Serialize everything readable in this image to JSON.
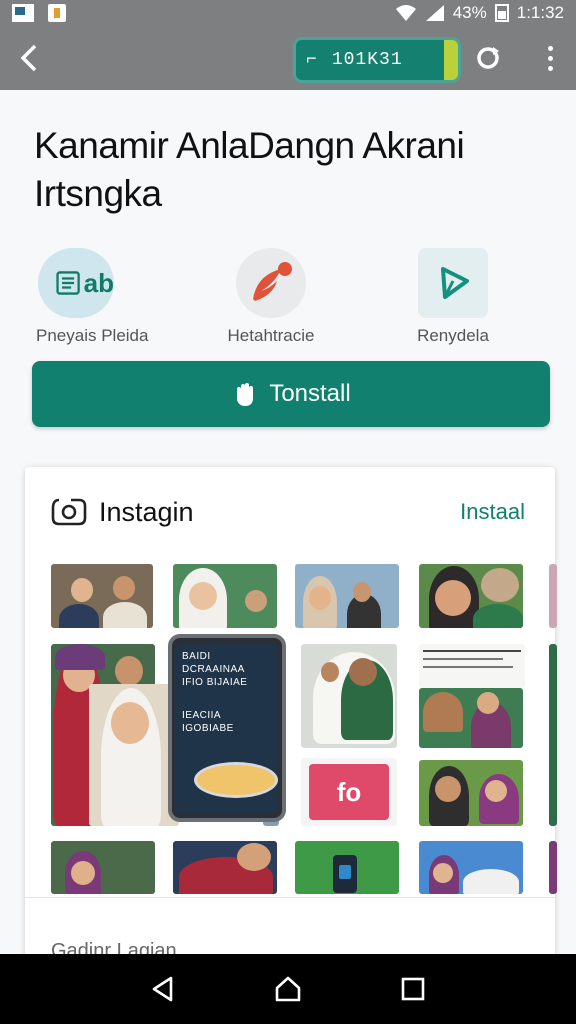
{
  "status_bar": {
    "battery": "43%",
    "time": "1:1:32",
    "icons": [
      "wifi-icon",
      "signal-icon",
      "battery-icon"
    ]
  },
  "toolbar": {
    "url_text": "101K31",
    "icons": [
      "back-arrow-icon",
      "refresh-icon",
      "overflow-menu-icon"
    ]
  },
  "app": {
    "title": "Kanamir AnlaDangn Akrani Irtsngka"
  },
  "quick_actions": [
    {
      "label": "Pneyais Pleida",
      "icon": "tablet-icon",
      "icon_text": "ab"
    },
    {
      "label": "Hetahtracie",
      "icon": "feather-icon"
    },
    {
      "label": "Renydela",
      "icon": "play-icon"
    }
  ],
  "install_button": {
    "label": "Tonstall",
    "icon": "hand-icon"
  },
  "card": {
    "title": "Instagin",
    "action": "Instaal",
    "icon": "instagram-icon",
    "phone_text": [
      "BAIDI DCRAAINAA",
      "IFIO BIJAIAE",
      "",
      "IEACIIA",
      "IGOBIABE"
    ],
    "badge_text": "fo",
    "footer": "Gadinr Lagian"
  },
  "colors": {
    "accent": "#11806f",
    "toolbar": "#7d7f80",
    "badge": "#e04a6a"
  },
  "nav_bar": {
    "icons": [
      "back-triangle-icon",
      "home-icon",
      "recents-icon"
    ]
  }
}
